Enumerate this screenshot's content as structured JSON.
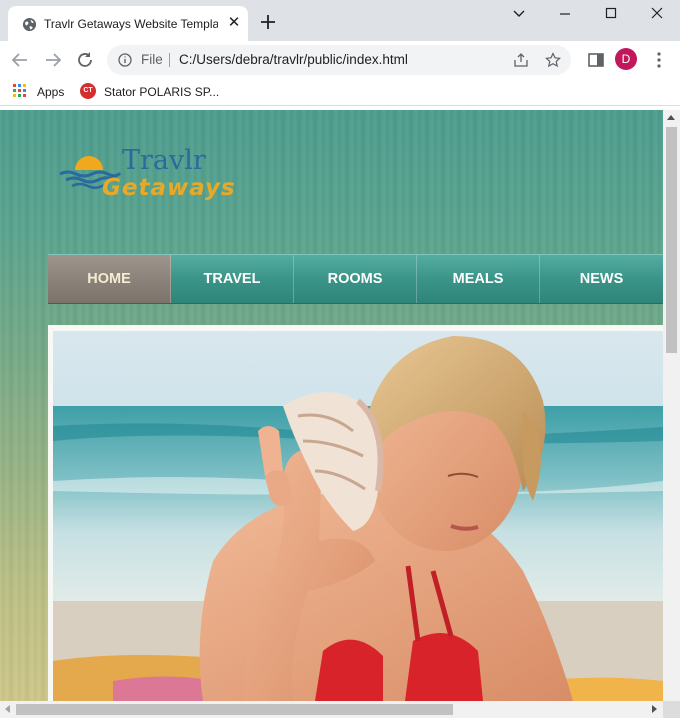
{
  "browser": {
    "tab": {
      "title": "Travlr Getaways Website Template",
      "favicon": "globe-icon",
      "close_label": "✕"
    },
    "new_tab_icon": "plus-icon",
    "window_controls": [
      "chevron-down-icon",
      "minimize-icon",
      "maximize-icon",
      "close-icon"
    ],
    "address": {
      "scheme_label": "File",
      "url": "C:/Users/debra/travlr/public/index.html"
    },
    "profile_initial": "D",
    "accent_color": "#c2185b"
  },
  "bookmarks": [
    {
      "label": "Apps",
      "icon": "apps-grid-icon"
    },
    {
      "label": "Stator POLARIS SP...",
      "icon": "ct-icon",
      "icon_text": "CT"
    }
  ],
  "page": {
    "logo": {
      "line1": "Travlr",
      "line2": "Getaways",
      "icon": "sunset-waves-icon"
    },
    "nav": {
      "items": [
        {
          "label": "HOME",
          "active": true
        },
        {
          "label": "TRAVEL",
          "active": false
        },
        {
          "label": "ROOMS",
          "active": false
        },
        {
          "label": "MEALS",
          "active": false
        },
        {
          "label": "NEWS",
          "active": false
        }
      ]
    },
    "hero_image": "woman-with-seashell-on-beach",
    "colors": {
      "nav_teal": "#3b9488",
      "nav_active": "#8a8178",
      "logo_blue": "#2a6a9e",
      "logo_gold": "#e8a928"
    }
  }
}
